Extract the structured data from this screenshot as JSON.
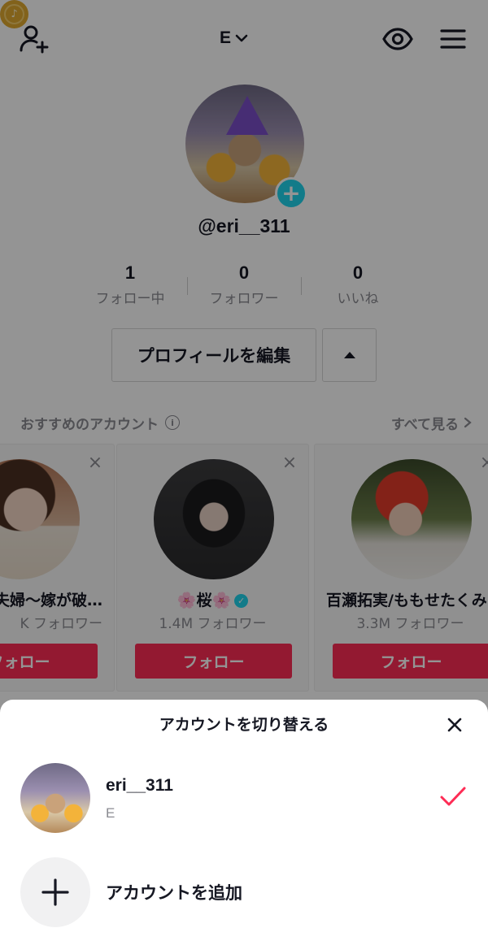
{
  "header": {
    "account_label": "E",
    "icons": [
      "add-user-icon",
      "coin-icon",
      "chevron-down-icon",
      "eye-icon",
      "menu-icon"
    ]
  },
  "profile": {
    "username": "@eri__311",
    "stats": [
      {
        "value": "1",
        "label": "フォロー中"
      },
      {
        "value": "0",
        "label": "フォロワー"
      },
      {
        "value": "0",
        "label": "いいね"
      }
    ],
    "edit_label": "プロフィールを編集"
  },
  "suggested": {
    "title": "おすすめのアカウント",
    "see_all": "すべて見る",
    "cards": [
      {
        "name": "夫婦〜嫁が破…",
        "followers": "K フォロワー",
        "follow": "フォロー"
      },
      {
        "name": "🌸桜🌸",
        "followers": "1.4M フォロワー",
        "follow": "フォロー",
        "verified": true
      },
      {
        "name": "百瀬拓実/ももせたくみ",
        "followers": "3.3M フォロワー",
        "follow": "フォロー"
      }
    ]
  },
  "sheet": {
    "title": "アカウントを切り替える",
    "account": {
      "name": "eri__311",
      "sub": "E"
    },
    "add_label": "アカウントを追加"
  },
  "colors": {
    "accent_red": "#fe2c55",
    "verified": "#20d5ec",
    "muted": "#8a8b91"
  }
}
